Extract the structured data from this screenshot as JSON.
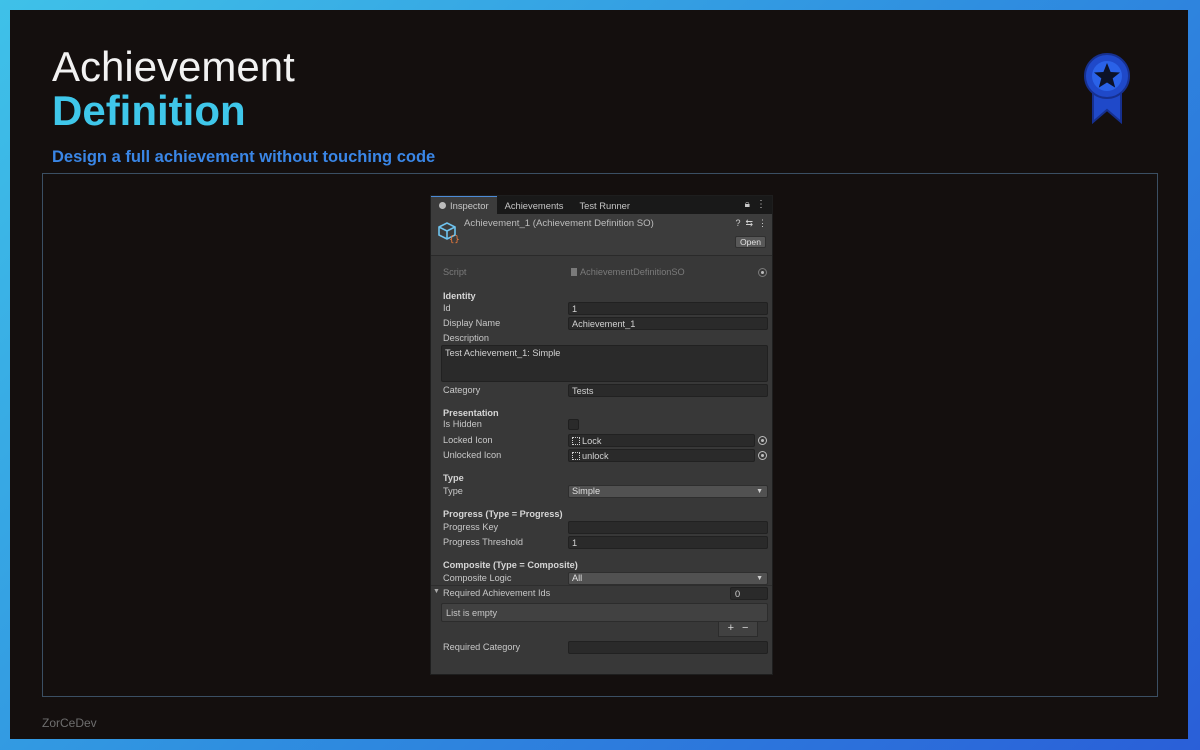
{
  "slide": {
    "title_line1": "Achievement",
    "title_line2": "Definition",
    "subtitle": "Design a full achievement without touching code",
    "footer": "ZorCeDev",
    "badge_icon": "award-ribbon-star-icon",
    "accent": "#3fc7ea",
    "subtitle_color": "#3a86e6"
  },
  "inspector": {
    "tabs": [
      "Inspector",
      "Achievements",
      "Test Runner"
    ],
    "asset_title": "Achievement_1 (Achievement Definition SO)",
    "open_label": "Open",
    "script": {
      "label": "Script",
      "value": "AchievementDefinitionSO"
    },
    "identity": {
      "header": "Identity",
      "id_label": "Id",
      "id_value": "1",
      "display_name_label": "Display Name",
      "display_name_value": "Achievement_1",
      "description_label": "Description",
      "description_value": "Test Achievement_1: Simple",
      "category_label": "Category",
      "category_value": "Tests"
    },
    "presentation": {
      "header": "Presentation",
      "is_hidden_label": "Is Hidden",
      "is_hidden_checked": false,
      "locked_icon_label": "Locked Icon",
      "locked_icon_value": "Lock",
      "unlocked_icon_label": "Unlocked Icon",
      "unlocked_icon_value": "unlock"
    },
    "type": {
      "header": "Type",
      "type_label": "Type",
      "type_value": "Simple"
    },
    "progress": {
      "header": "Progress (Type = Progress)",
      "key_label": "Progress Key",
      "key_value": "",
      "threshold_label": "Progress Threshold",
      "threshold_value": "1"
    },
    "composite": {
      "header": "Composite (Type = Composite)",
      "logic_label": "Composite Logic",
      "logic_value": "All",
      "required_ids_label": "Required Achievement Ids",
      "required_ids_count": "0",
      "empty_text": "List is empty",
      "add_label": "+",
      "remove_label": "−",
      "required_category_label": "Required Category",
      "required_category_value": ""
    }
  }
}
